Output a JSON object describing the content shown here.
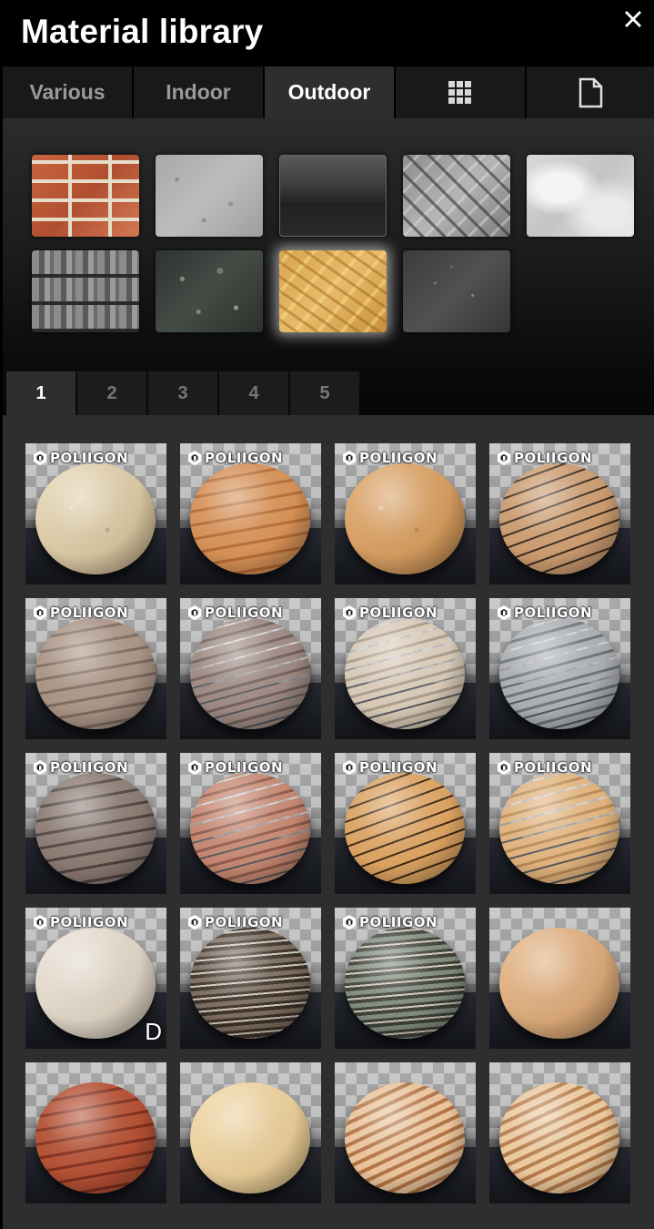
{
  "window": {
    "title": "Material library",
    "close_icon": "close-icon"
  },
  "tabs": [
    {
      "label": "Various",
      "active": false
    },
    {
      "label": "Indoor",
      "active": false
    },
    {
      "label": "Outdoor",
      "active": true
    },
    {
      "label": "",
      "icon": "grid-icon",
      "active": false
    },
    {
      "label": "",
      "icon": "document-icon",
      "active": false
    }
  ],
  "categories": [
    {
      "name": "brick",
      "selected": false
    },
    {
      "name": "concrete",
      "selected": false
    },
    {
      "name": "glass",
      "selected": false
    },
    {
      "name": "diamond-plate",
      "selected": false
    },
    {
      "name": "plaster",
      "selected": false
    },
    {
      "name": "roof-tiles",
      "selected": false
    },
    {
      "name": "granite",
      "selected": false
    },
    {
      "name": "osb-wood",
      "selected": true
    },
    {
      "name": "asphalt",
      "selected": false
    }
  ],
  "pagination": {
    "pages": [
      "1",
      "2",
      "3",
      "4",
      "5"
    ],
    "active": "1"
  },
  "materials": [
    {
      "brand": "POLIIGON",
      "badge": "",
      "colors": [
        "#e7d9b8",
        "#c7b38d"
      ],
      "pattern": "speckle"
    },
    {
      "brand": "POLIIGON",
      "badge": "",
      "colors": [
        "#d48f55",
        "#b36a35"
      ],
      "pattern": "grain"
    },
    {
      "brand": "POLIIGON",
      "badge": "",
      "colors": [
        "#dfa96f",
        "#c68e52"
      ],
      "pattern": "speckle"
    },
    {
      "brand": "POLIIGON",
      "badge": "",
      "colors": [
        "#c99a6e",
        "#3a2a1e"
      ],
      "pattern": "planks"
    },
    {
      "brand": "POLIIGON",
      "badge": "",
      "colors": [
        "#a89384",
        "#7d6a5f"
      ],
      "pattern": "grain"
    },
    {
      "brand": "POLIIGON",
      "badge": "",
      "colors": [
        "#9c8880",
        "#6e5f5a"
      ],
      "pattern": "planks-light"
    },
    {
      "brand": "POLIIGON",
      "badge": "",
      "colors": [
        "#d7c8b5",
        "#a99a88"
      ],
      "pattern": "planks-light"
    },
    {
      "brand": "POLIIGON",
      "badge": "",
      "colors": [
        "#a9adb2",
        "#6d7176"
      ],
      "pattern": "planks-light"
    },
    {
      "brand": "POLIIGON",
      "badge": "",
      "colors": [
        "#8b7a72",
        "#4e4440"
      ],
      "pattern": "grain"
    },
    {
      "brand": "POLIIGON",
      "badge": "",
      "colors": [
        "#c48670",
        "#8e5a4a"
      ],
      "pattern": "planks-light"
    },
    {
      "brand": "POLIIGON",
      "badge": "",
      "colors": [
        "#d9a160",
        "#3d2614"
      ],
      "pattern": "planks"
    },
    {
      "brand": "POLIIGON",
      "badge": "",
      "colors": [
        "#dfb27c",
        "#b88954"
      ],
      "pattern": "planks-light"
    },
    {
      "brand": "POLIIGON",
      "badge": "D",
      "colors": [
        "#ece4d8",
        "#cbbfae"
      ],
      "pattern": "smooth"
    },
    {
      "brand": "POLIIGON",
      "badge": "",
      "colors": [
        "#7a6b5e",
        "#3c3128"
      ],
      "pattern": "bark"
    },
    {
      "brand": "POLIIGON",
      "badge": "",
      "colors": [
        "#7f8a7c",
        "#3f4038"
      ],
      "pattern": "bark"
    },
    {
      "brand": "",
      "badge": "",
      "colors": [
        "#e7b98b",
        "#c99767"
      ],
      "pattern": "smooth"
    },
    {
      "brand": "",
      "badge": "",
      "colors": [
        "#b24f33",
        "#7e2e1d"
      ],
      "pattern": "grain"
    },
    {
      "brand": "",
      "badge": "",
      "colors": [
        "#f2d9a8",
        "#d9bb86"
      ],
      "pattern": "smooth"
    },
    {
      "brand": "",
      "badge": "",
      "colors": [
        "#e8c29a",
        "#b17244"
      ],
      "pattern": "stripes"
    },
    {
      "brand": "",
      "badge": "",
      "colors": [
        "#eac79c",
        "#b47b4a"
      ],
      "pattern": "stripes"
    }
  ]
}
